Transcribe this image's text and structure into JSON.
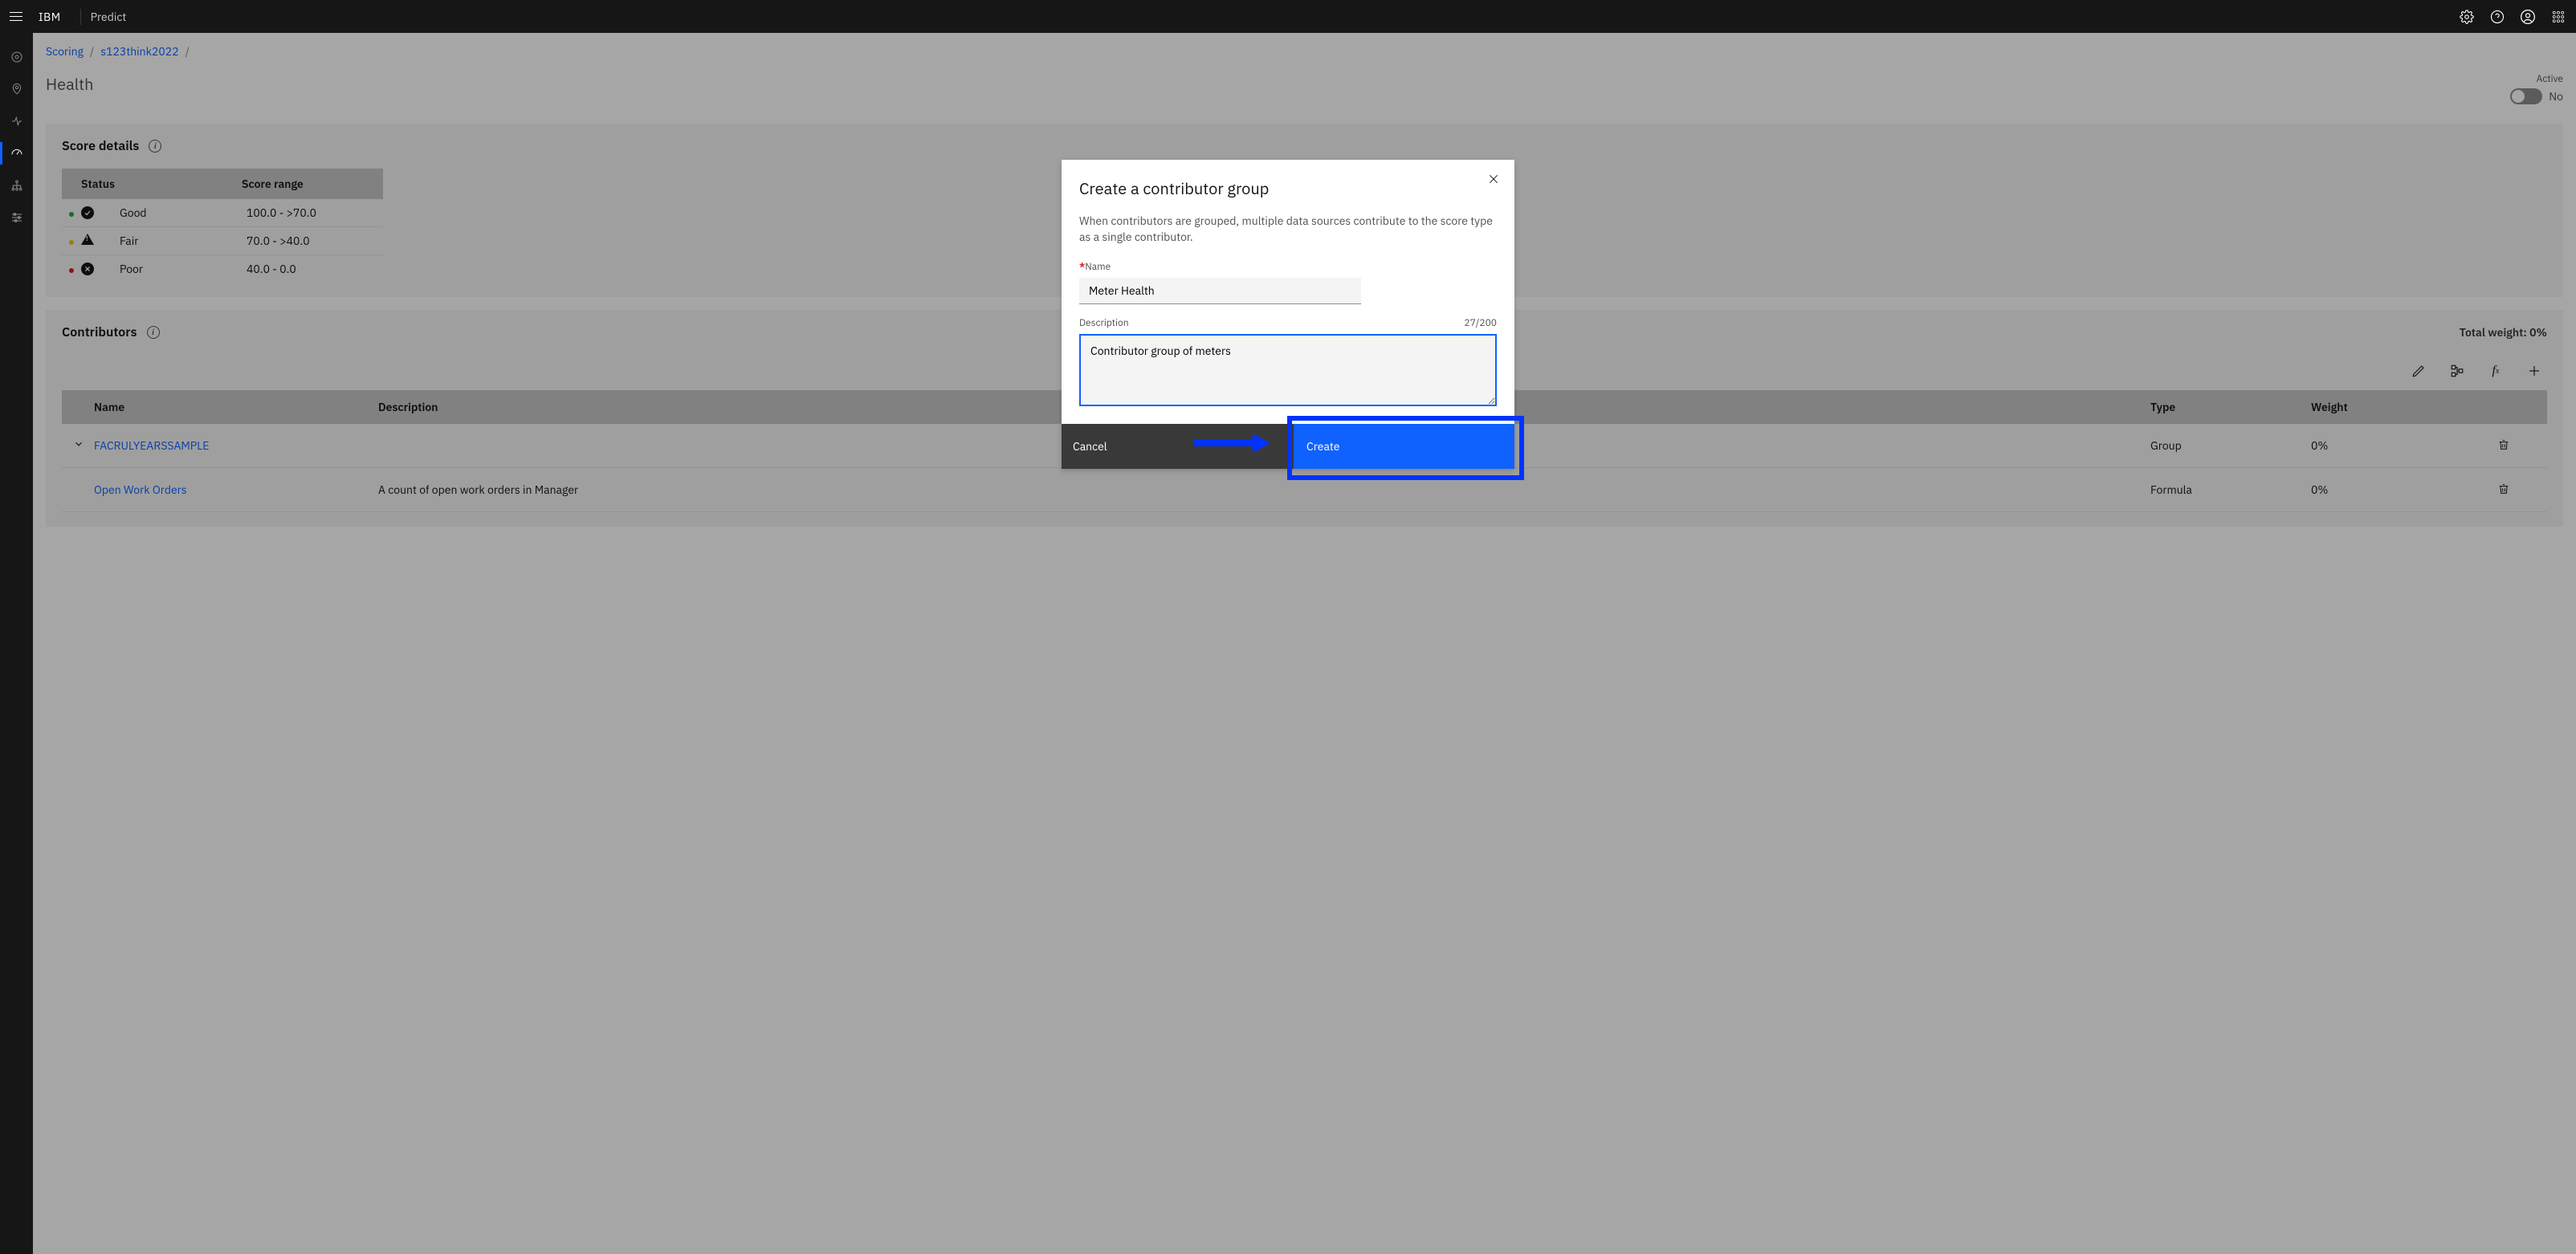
{
  "header": {
    "brand": "IBM",
    "app": "Predict"
  },
  "breadcrumb": {
    "a": "Scoring",
    "b": "s123think2022"
  },
  "page": {
    "title": "Health",
    "active_label": "Active",
    "toggle_text": "No"
  },
  "score_details": {
    "title": "Score details",
    "col_status": "Status",
    "col_range": "Score range",
    "rows": [
      {
        "label": "Good",
        "range": "100.0 - >70.0"
      },
      {
        "label": "Fair",
        "range": "70.0 - >40.0"
      },
      {
        "label": "Poor",
        "range": "40.0 - 0.0"
      }
    ]
  },
  "contributors": {
    "title": "Contributors",
    "total_weight": "Total weight: 0%",
    "col_name": "Name",
    "col_desc": "Description",
    "col_type": "Type",
    "col_weight": "Weight",
    "rows": [
      {
        "name": "FACRULYEARSSAMPLE",
        "desc": "",
        "type": "Group",
        "weight": "0%"
      },
      {
        "name": "Open Work Orders",
        "desc": "A count of open work orders in Manager",
        "type": "Formula",
        "weight": "0%"
      }
    ]
  },
  "modal": {
    "title": "Create a contributor group",
    "desc": "When contributors are grouped, multiple data sources contribute to the score type as a single contributor.",
    "name_label": "Name",
    "name_value": "Meter Health",
    "desc_label": "Description",
    "desc_counter": "27/200",
    "desc_value": "Contributor group of meters",
    "cancel": "Cancel",
    "create": "Create"
  }
}
